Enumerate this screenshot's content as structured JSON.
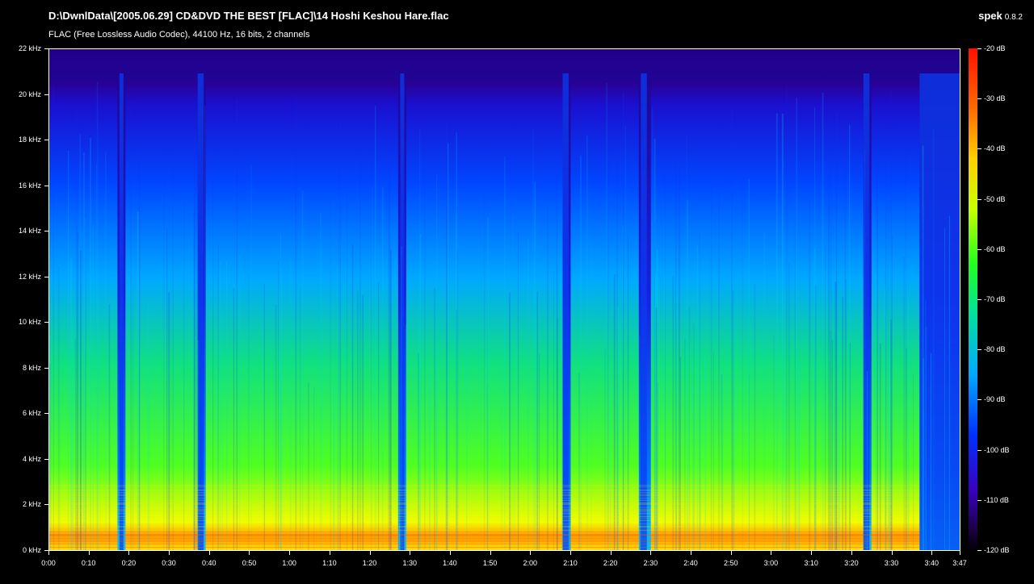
{
  "window": {
    "title": "D:\\DwnlData\\[2005.06.29] CD&DVD THE BEST [FLAC]\\14 Hoshi Keshou Hare.flac",
    "subtitle": "FLAC (Free Lossless Audio Codec), 44100 Hz, 16 bits, 2 channels",
    "app_name": "spek",
    "app_version": "0.8.2"
  },
  "chart_data": {
    "type": "heatmap",
    "title": "D:\\DwnlData\\[2005.06.29] CD&DVD THE BEST [FLAC]\\14 Hoshi Keshou Hare.flac",
    "xlabel": "",
    "ylabel": "",
    "y_ticks": [
      "22 kHz",
      "20 kHz",
      "18 kHz",
      "16 kHz",
      "14 kHz",
      "12 kHz",
      "10 kHz",
      "8 kHz",
      "6 kHz",
      "4 kHz",
      "2 kHz",
      "0 kHz"
    ],
    "y_range_khz": [
      0,
      22
    ],
    "x_ticks": [
      "0:00",
      "0:10",
      "0:20",
      "0:30",
      "0:40",
      "0:50",
      "1:00",
      "1:10",
      "1:20",
      "1:30",
      "1:40",
      "1:50",
      "2:00",
      "2:10",
      "2:20",
      "2:30",
      "2:40",
      "2:50",
      "3:00",
      "3:10",
      "3:20",
      "3:30",
      "3:40",
      "3:47"
    ],
    "x_range_seconds": [
      0,
      227
    ],
    "colorbar_ticks": [
      "-20 dB",
      "-30 dB",
      "-40 dB",
      "-50 dB",
      "-60 dB",
      "-70 dB",
      "-80 dB",
      "-90 dB",
      "-100 dB",
      "-110 dB",
      "-120 dB"
    ],
    "colorbar_range_db": [
      -120,
      -20
    ],
    "loud_sections_seconds": [
      [
        0,
        17
      ],
      [
        19,
        37
      ],
      [
        39,
        87
      ],
      [
        89,
        128
      ],
      [
        130,
        147
      ],
      [
        150,
        203
      ],
      [
        205,
        217
      ]
    ],
    "quiet_gaps_seconds": [
      [
        17.5,
        18.5
      ],
      [
        37,
        38.5
      ],
      [
        87.5,
        88.5
      ],
      [
        128,
        129.5
      ],
      [
        147.5,
        149
      ],
      [
        203,
        204.5
      ],
      [
        217,
        227
      ]
    ]
  }
}
